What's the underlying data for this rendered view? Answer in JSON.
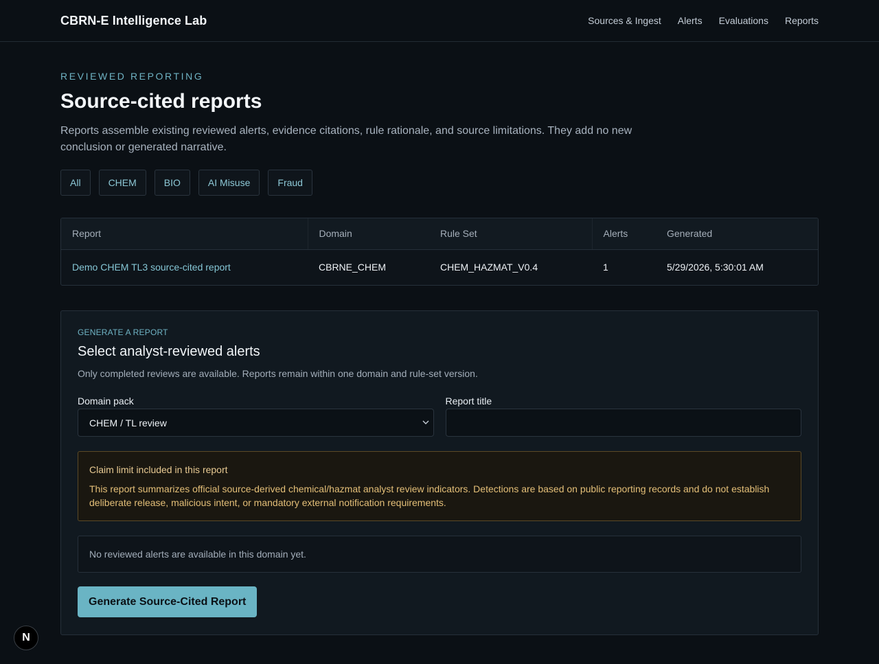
{
  "app": {
    "title": "CBRN-E Intelligence Lab",
    "nav": [
      "Sources & Ingest",
      "Alerts",
      "Evaluations",
      "Reports"
    ]
  },
  "page": {
    "eyebrow": "REVIEWED REPORTING",
    "title": "Source-cited reports",
    "description": "Reports assemble existing reviewed alerts, evidence citations, rule rationale, and source limitations. They add no new conclusion or generated narrative."
  },
  "filters": [
    "All",
    "CHEM",
    "BIO",
    "AI Misuse",
    "Fraud"
  ],
  "table": {
    "headers": [
      "Report",
      "Domain",
      "Rule Set",
      "Alerts",
      "Generated"
    ],
    "rows": [
      {
        "report": "Demo CHEM TL3 source-cited report",
        "domain": "CBRNE_CHEM",
        "rule_set": "CHEM_HAZMAT_V0.4",
        "alerts": "1",
        "generated": "5/29/2026, 5:30:01 AM"
      }
    ]
  },
  "generator": {
    "eyebrow": "GENERATE A REPORT",
    "title": "Select analyst-reviewed alerts",
    "subtitle": "Only completed reviews are available. Reports remain within one domain and rule-set version.",
    "domain_label": "Domain pack",
    "domain_value": "CHEM / TL review",
    "title_label": "Report title",
    "title_value": "",
    "claim_title": "Claim limit included in this report",
    "claim_body": "This report summarizes official source-derived chemical/hazmat analyst review indicators. Detections are based on public reporting records and do not establish deliberate release, malicious intent, or mandatory external notification requirements.",
    "empty_message": "No reviewed alerts are available in this domain yet.",
    "button_label": "Generate Source-Cited Report"
  },
  "badge": {
    "letter": "N"
  },
  "colors": {
    "background": "#0b1015",
    "accent": "#6ab4c4",
    "warning_text": "#e4bf78"
  }
}
